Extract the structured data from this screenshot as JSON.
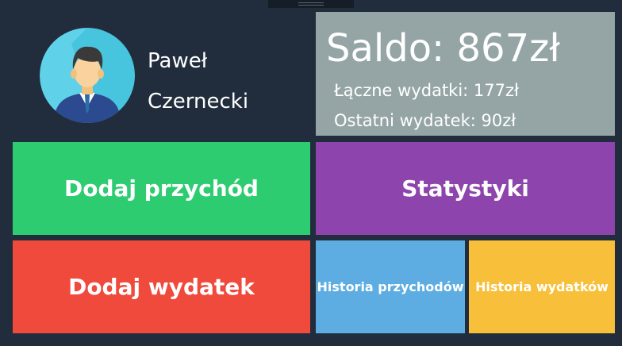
{
  "user": {
    "first_name": "Paweł",
    "last_name": "Czernecki"
  },
  "balance_panel": {
    "balance": "Saldo: 867zł",
    "total_expenses": "Łączne wydatki: 177zł",
    "last_expense": "Ostatni wydatek: 90zł"
  },
  "tiles": {
    "add_income": "Dodaj przychód",
    "statistics": "Statystyki",
    "add_expense": "Dodaj wydatek",
    "income_history": "Historia przychodów",
    "expense_history": "Historia wydatków"
  },
  "colors": {
    "background": "#212d3c",
    "balance_panel": "#95a5a6",
    "add_income": "#2ecc71",
    "statistics": "#8e44ad",
    "add_expense": "#f04a3c",
    "income_history": "#5dade2",
    "expense_history": "#f8c03a"
  },
  "icons": {
    "avatar": "user-avatar-icon"
  }
}
